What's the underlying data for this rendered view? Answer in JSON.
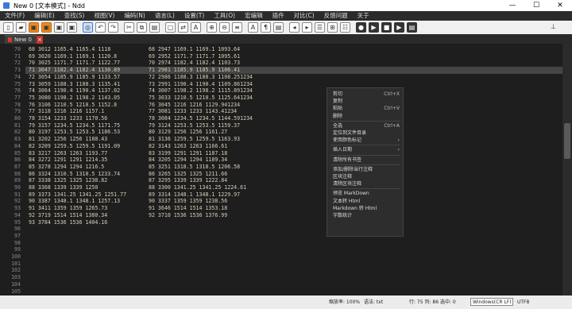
{
  "window": {
    "title": "New 0 [文本模式] - Ndd",
    "controls": [
      "—",
      "☐",
      "✕"
    ]
  },
  "menu": [
    "文件(F)",
    "编辑(E)",
    "查找(S)",
    "视图(V)",
    "编码(N)",
    "语言(L)",
    "设置(T)",
    "工具(O)",
    "宏编辑",
    "插件",
    "对比(C)",
    "反馈问题",
    "关于"
  ],
  "toolbar": {
    "icons": [
      "new-file-icon",
      "open-folder-icon",
      "save-icon",
      "save-all-icon",
      "close-file-icon",
      "close-all-icon",
      "text-mode-icon",
      "undo-icon",
      "redo-icon",
      "cut-icon",
      "copy-icon",
      "paste-icon",
      "find-icon",
      "replace-icon",
      "font-icon",
      "zoom-in-icon",
      "zoom-out-icon",
      "wrap-icon",
      "word-wrap-icon",
      "indent-guide-icon",
      "show-all-chars-icon",
      "prev-icon",
      "next-icon",
      "list-icon",
      "compare-icon",
      "rule-icon",
      "record-macro-icon",
      "play-macro-icon",
      "stop-macro-icon",
      "run-macro-icon",
      "save-macro-icon",
      "pin-icon"
    ],
    "glyphs": [
      "▯",
      "▰",
      "▣",
      "▣",
      "▣",
      "▣",
      "◎",
      "↶",
      "↷",
      "✂",
      "⧉",
      "▤",
      "▢",
      "⇄",
      "A",
      "⊕",
      "⊖",
      "≡",
      "A",
      "¶",
      "▤",
      "◂",
      "▸",
      "☰",
      "⊞",
      "☷",
      "●",
      "▶",
      "■",
      "▶",
      "▤",
      "⊥"
    ]
  },
  "tab": {
    "label": "New 0",
    "close": "×"
  },
  "editor": {
    "first_line_number": 70,
    "line_numbers": [
      "70",
      "71",
      "72",
      "73",
      "74",
      "75",
      "76",
      "77",
      "78",
      "79",
      "80",
      "81",
      "82",
      "83",
      "84",
      "85",
      "86",
      "87",
      "88",
      "89",
      "90",
      "91",
      "92",
      "93",
      "94",
      "95",
      "96",
      "97",
      "98",
      "99",
      "100",
      "101",
      "102",
      "103",
      "104",
      "105"
    ],
    "highlight_index": 3,
    "col1": [
      "68 3012 1165.4 1165.4 1118",
      "69 3020 1169.1 1169.1 1120.8",
      "70 3025 1171.7 1171.7 1122.77",
      "71 3047 1182.4 1182.4 1130.89",
      "72 3054 1185.9 1185.9 1133.57",
      "73 3059 1188.3 1188.3 1135.41",
      "74 3064 1190.4 1190.4 1137.02",
      "75 3080 1198.2 1198.2 1143.05",
      "76 3106 1210.5 1210.5 1152.8",
      "77 3118 1216 1216 1157.1",
      "78 3154 1233 1233 1170.56",
      "79 3157 1234.5 1234.5 1171.75",
      "80 3197 1253.5 1253.5 1186.53",
      "81 3202 1256 1256 1188.43",
      "82 3209 1259.5 1259.5 1191.09",
      "83 3217 1263 1263 1193.77",
      "84 3272 1291 1291 1214.35",
      "85 3278 1294 1294 1216.5",
      "86 3324 1310.5 1310.5 1233.74",
      "87 3338 1325 1325 1238.82",
      "88 3368 1339 1339 1250",
      "89 3373 1341.25 1341.25 1251.77",
      "90 3387 1348.1 1348.1 1257.13",
      "91 3411 1359 1359 1265.73",
      "92 3719 1514 1514 1380.34",
      "93 3784 1536 1536 1404.16"
    ],
    "col2": [
      "68 2947 1169.1 1169.1 1093.64",
      "69 2952 1171.7 1171.7 1095.61",
      "70 2974 1182.4 1182.4 1103.73",
      "71 2981 1185.9 1185.9 1106.41",
      "72 2986 1188.3 1188.3 1108.251234",
      "73 2991 1190.4 1190.4 1109.861234",
      "74 3007 1198.2 1198.2 1115.891234",
      "75 3033 1210.5 1210.5 1125.641234",
      "76 3045 1216 1216 1129.941234",
      "77 3081 1233 1233 1143.41234",
      "78 3084 1234.5 1234.5 1144.591234",
      "79 3124 1253.5 1253.5 1159.37",
      "80 3129 1256 1256 1161.27",
      "81 3136 1259.5 1259.5 1163.93",
      "82 3143 1263 1263 1166.61",
      "83 3199 1291 1291 1187.18",
      "84 3205 1294 1294 1189.34",
      "85 3251 1318.5 1318.5 1206.58",
      "86 3265 1325 1325 1211.66",
      "87 3295 1339 1339 1222.84",
      "88 3300 1341.25 1341.25 1224.61",
      "89 3314 1348.1 1348.1 1229.97",
      "90 3337 1359 1359 1238.56",
      "91 3646 1514 1514 1353.18",
      "92 3710 1536 1536 1376.99"
    ]
  },
  "context_menu": [
    {
      "label": "剪切",
      "shortcut": "Ctrl+X"
    },
    {
      "label": "复制",
      "shortcut": ""
    },
    {
      "label": "粘贴",
      "shortcut": "Ctrl+V"
    },
    {
      "label": "删除",
      "shortcut": ""
    },
    {
      "sep": true
    },
    {
      "label": "全选",
      "shortcut": "Ctrl+A"
    },
    {
      "label": "定位到文件目录",
      "shortcut": ""
    },
    {
      "label": "使用颜色标记",
      "shortcut": "›"
    },
    {
      "sep": true
    },
    {
      "label": "插入日期",
      "shortcut": "›"
    },
    {
      "sep": true
    },
    {
      "label": "清除所有书签",
      "shortcut": ""
    },
    {
      "sep": true
    },
    {
      "label": "添加/删除当行注释",
      "shortcut": ""
    },
    {
      "label": "区块注释",
      "shortcut": ""
    },
    {
      "label": "清除区块注释",
      "shortcut": ""
    },
    {
      "sep": true
    },
    {
      "label": "预览 MarkDown",
      "shortcut": ""
    },
    {
      "label": "文本转 Html",
      "shortcut": ""
    },
    {
      "label": "Markdown 转 Html",
      "shortcut": ""
    },
    {
      "label": "字数统计",
      "shortcut": ""
    }
  ],
  "status": {
    "zoom": "缩放率: 100%",
    "lang": "语法: txt",
    "position": "行: 75  列: 86  选中: 0",
    "encoding": "Windows(CR LF)",
    "charset": "UTF8"
  },
  "colors": {
    "editor_bg": "#1e1e1e",
    "code_text": "#d8cfb8",
    "line_highlight": "#454545",
    "toolbar_accent": "#ec8b22"
  }
}
